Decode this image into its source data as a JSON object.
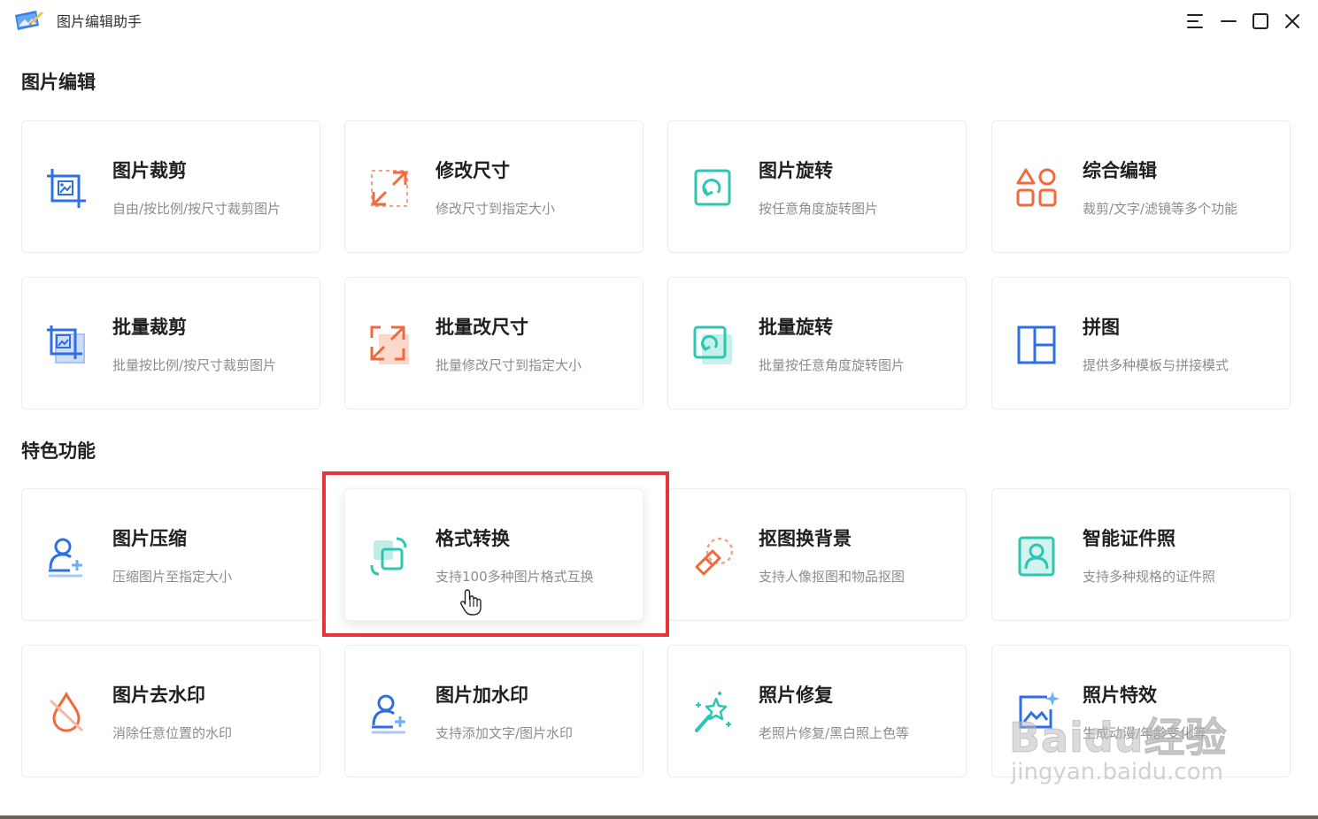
{
  "window": {
    "title": "图片编辑助手",
    "controls": [
      "menu-icon",
      "minimize-icon",
      "maximize-icon",
      "close-icon"
    ]
  },
  "sections": [
    {
      "title": "图片编辑",
      "cards": [
        {
          "name": "图片裁剪",
          "desc": "自由/按比例/按尺寸裁剪图片",
          "icon": "crop-icon",
          "color": "#2f6fe4"
        },
        {
          "name": "修改尺寸",
          "desc": "修改尺寸到指定大小",
          "icon": "resize-icon",
          "color": "#f06a3c"
        },
        {
          "name": "图片旋转",
          "desc": "按任意角度旋转图片",
          "icon": "rotate-icon",
          "color": "#2cc6b2"
        },
        {
          "name": "综合编辑",
          "desc": "裁剪/文字/滤镜等多个功能",
          "icon": "shapes-icon",
          "color": "#f06a3c"
        },
        {
          "name": "批量裁剪",
          "desc": "批量按比例/按尺寸裁剪图片",
          "icon": "batch-crop-icon",
          "color": "#2f6fe4"
        },
        {
          "name": "批量改尺寸",
          "desc": "批量修改尺寸到指定大小",
          "icon": "batch-resize-icon",
          "color": "#f06a3c"
        },
        {
          "name": "批量旋转",
          "desc": "批量按任意角度旋转图片",
          "icon": "batch-rotate-icon",
          "color": "#2cc6b2"
        },
        {
          "name": "拼图",
          "desc": "提供多种模板与拼接模式",
          "icon": "collage-icon",
          "color": "#2f6fe4"
        }
      ]
    },
    {
      "title": "特色功能",
      "cards": [
        {
          "name": "图片压缩",
          "desc": "压缩图片至指定大小",
          "icon": "compress-icon",
          "color": "#2f6fe4"
        },
        {
          "name": "格式转换",
          "desc": "支持100多种图片格式互换",
          "icon": "format-convert-icon",
          "color": "#2cc6b2"
        },
        {
          "name": "抠图换背景",
          "desc": "支持人像抠图和物品抠图",
          "icon": "eraser-icon",
          "color": "#f06a3c"
        },
        {
          "name": "智能证件照",
          "desc": "支持多种规格的证件照",
          "icon": "id-photo-icon",
          "color": "#2cc6b2"
        },
        {
          "name": "图片去水印",
          "desc": "消除任意位置的水印",
          "icon": "remove-watermark-icon",
          "color": "#f06a3c"
        },
        {
          "name": "图片加水印",
          "desc": "支持添加文字/图片水印",
          "icon": "add-watermark-icon",
          "color": "#2f6fe4"
        },
        {
          "name": "照片修复",
          "desc": "老照片修复/黑白照上色等",
          "icon": "magic-wand-icon",
          "color": "#2cc6b2"
        },
        {
          "name": "照片特效",
          "desc": "生成动漫/年龄变化等",
          "icon": "photo-effect-icon",
          "color": "#2f6fe4"
        }
      ]
    }
  ],
  "watermark": {
    "logo": "Baidu经验",
    "url": "jingyan.baidu.com"
  }
}
